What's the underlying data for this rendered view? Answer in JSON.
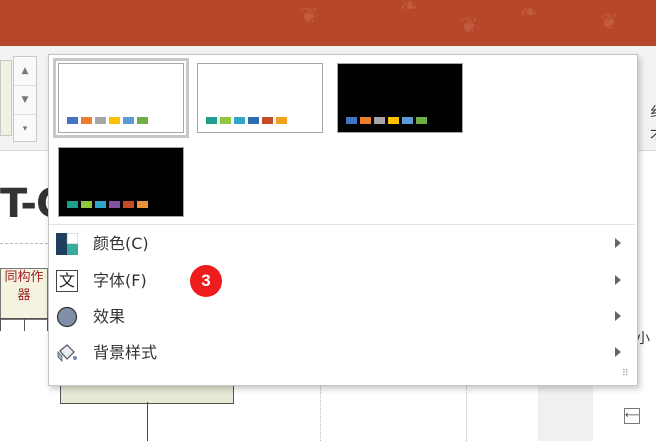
{
  "ribbon": {
    "right_chars": [
      "纟",
      "才"
    ]
  },
  "slide": {
    "title_fragment": "T-C",
    "org_box_text": "同构作器"
  },
  "side": {
    "small_text": "小"
  },
  "variants": [
    {
      "background": "#ffffff",
      "selected": true,
      "swatches": [
        "#4472c4",
        "#ed7d31",
        "#a5a5a5",
        "#ffc000",
        "#5b9bd5",
        "#70ad47"
      ]
    },
    {
      "background": "#ffffff",
      "selected": false,
      "swatches": [
        "#1e9e8b",
        "#8fc73e",
        "#30a6c9",
        "#2c6cb0",
        "#c54a25",
        "#f0a21e"
      ]
    },
    {
      "background": "#000000",
      "selected": false,
      "swatches": [
        "#4472c4",
        "#ed7d31",
        "#a5a5a5",
        "#ffc000",
        "#5b9bd5",
        "#70ad47"
      ]
    },
    {
      "background": "#000000",
      "selected": false,
      "swatches": [
        "#1e9e8b",
        "#8fc73e",
        "#30a6c9",
        "#8153a1",
        "#c54a25",
        "#e8943a"
      ]
    }
  ],
  "menu": {
    "colors_label": "颜色(C)",
    "fonts_label": "字体(F)",
    "effects_label": "效果",
    "background_label": "背景样式",
    "fonts_icon_char": "文"
  },
  "badge": "3",
  "colors": {
    "accent_title": "#b7472a",
    "badge": "#ee1c1c"
  }
}
